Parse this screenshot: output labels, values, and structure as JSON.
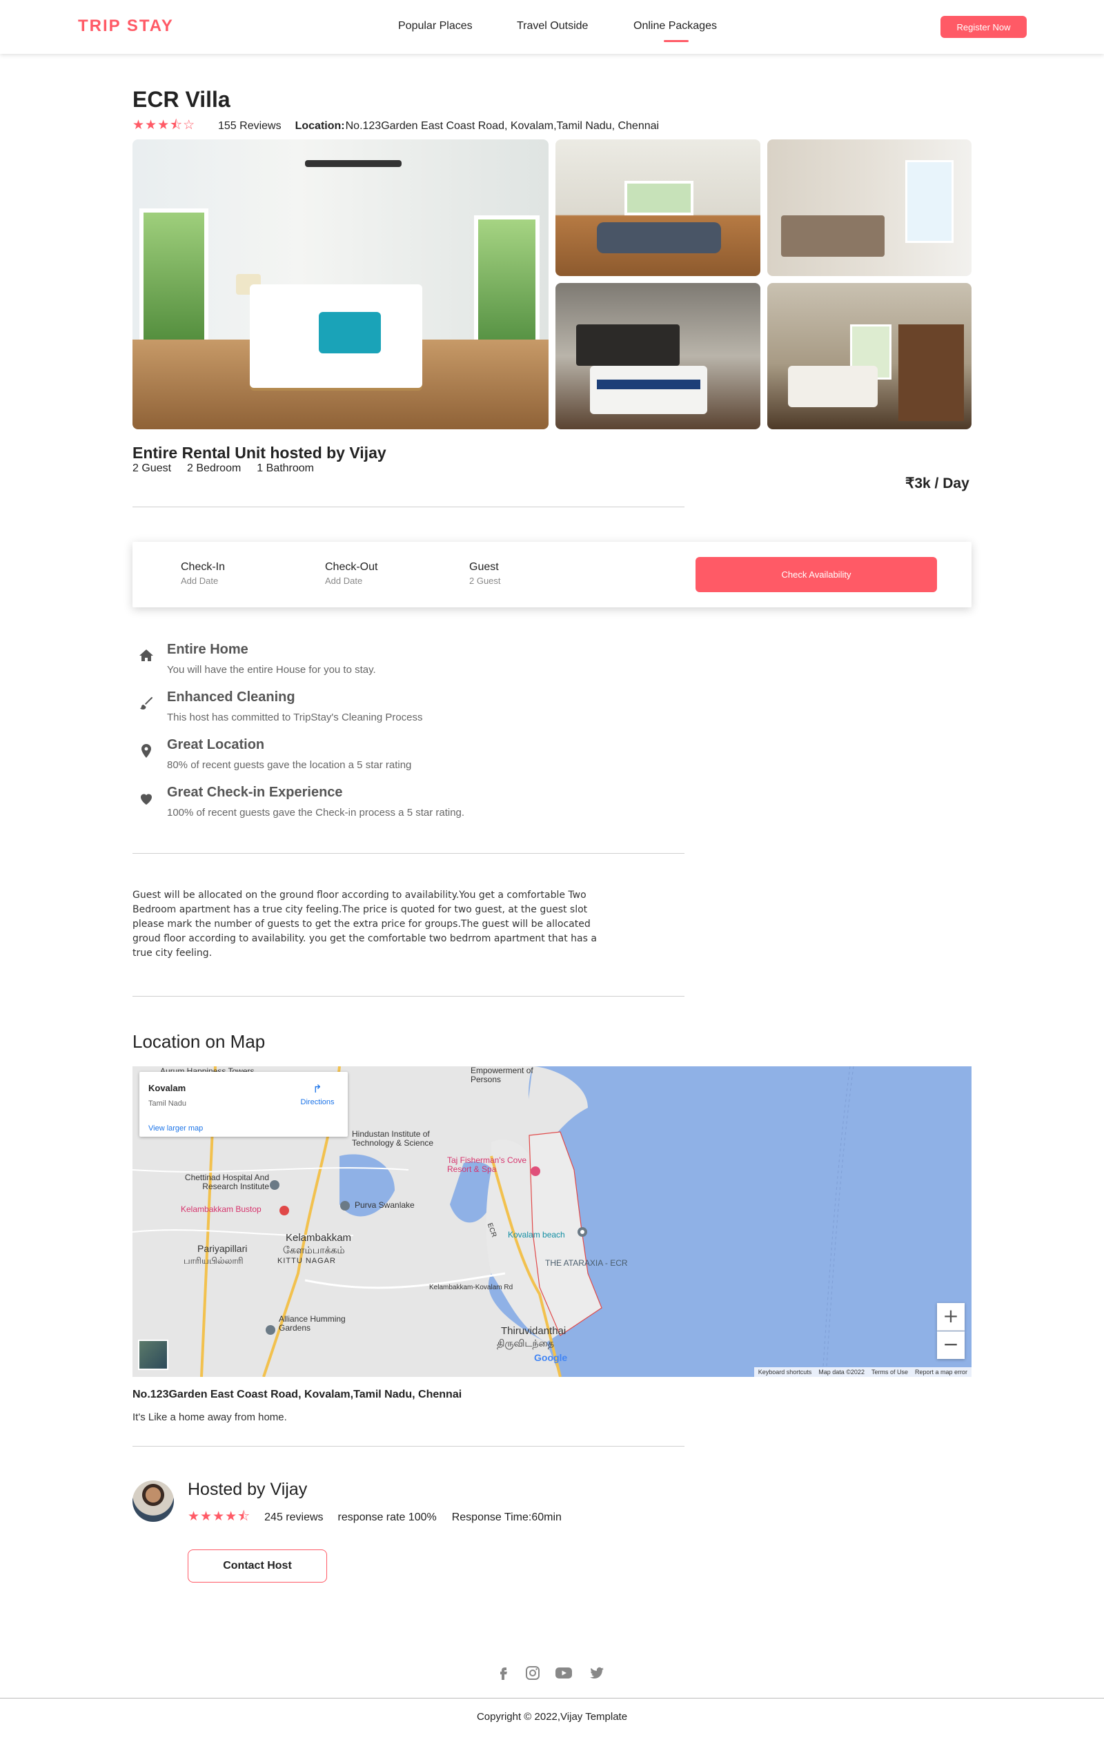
{
  "nav": {
    "logo": "TRIP STAY",
    "links": [
      "Popular Places",
      "Travel Outside",
      "Online Packages"
    ],
    "active_link": "Online Packages",
    "register_label": "Register Now",
    "accent_color": "#ff5a66"
  },
  "listing": {
    "title": "ECR Villa",
    "rating": 3.5,
    "rating_stars": "★★★⯪☆",
    "reviews": "155 Reviews",
    "location_label": "Location:",
    "location_value": "No.123Garden East Coast Road, Kovalam,Tamil Nadu, Chennai"
  },
  "rental": {
    "title": "Entire Rental Unit hosted by Vijay",
    "guests": "2 Guest",
    "bedrooms": "2 Bedroom",
    "bathrooms": "1 Bathroom",
    "price": "₹3k / Day"
  },
  "booking": {
    "checkin_label": "Check-In",
    "checkin_sub": "Add Date",
    "checkout_label": "Check-Out",
    "checkout_sub": "Add Date",
    "guest_label": "Guest",
    "guest_sub": "2 Guest",
    "button_label": "Check Availability"
  },
  "features": [
    {
      "icon": "home-icon",
      "title": "Entire Home",
      "desc": "You will have the entire House for you to stay."
    },
    {
      "icon": "brush-icon",
      "title": "Enhanced Cleaning",
      "desc": "This host has committed to TripStay's Cleaning Process"
    },
    {
      "icon": "map-pin-icon",
      "title": "Great Location",
      "desc": "80% of recent guests gave the location a 5 star rating"
    },
    {
      "icon": "heart-icon",
      "title": "Great Check-in Experience",
      "desc": "100% of recent guests gave the Check-in process a 5 star rating."
    }
  ],
  "description": "Guest will be allocated on the ground floor according to availability.You get a comfortable Two Bedroom apartment has a true city feeling.The price is quoted for two guest, at the guest slot please mark the number of guests to get the extra price for groups.The guest will be allocated groud floor according to availability. you get the comfortable two bedrrom apartment that has a true city feeling.",
  "map": {
    "heading": "Location on Map",
    "card_place": "Kovalam",
    "card_region": "Tamil Nadu",
    "card_directions": "Directions",
    "card_larger": "View larger map",
    "labels": {
      "aurum": "Aurum Happiness Towers",
      "empowerment": "Empowerment of Persons",
      "hindustan": "Hindustan Institute of Technology & Science",
      "chettinad": "Chettinad Hospital And Research Institute",
      "bustop": "Kelambakkam Bustop",
      "purva": "Purva Swanlake",
      "kelambakkam": "Kelambakkam",
      "kelambakkam_ta": "கேளம்பாக்கம்",
      "pariyapillari": "Pariyapillari",
      "pariyapillari_ta": "பாரியபில்லாரி",
      "kittu": "KITTU NAGAR",
      "taj": "Taj Fisherman's Cove Resort & Spa",
      "kovalam_beach": "Kovalam beach",
      "ataraxia": "THE ATARAXIA - ECR",
      "alliance": "Alliance Humming Gardens",
      "thiruvidanthai": "Thiruvidanthai",
      "thiruvidanthai_ta": "திருவிடந்தை",
      "ecr": "ECR",
      "kovalam_rd": "Kelambakkam-Kovalam Rd",
      "google": "Google"
    },
    "zoom_in": "+",
    "zoom_out": "−",
    "footer": [
      "Keyboard shortcuts",
      "Map data ©2022",
      "Terms of Use",
      "Report a map error"
    ]
  },
  "address": {
    "line": "No.123Garden East Coast Road, Kovalam,Tamil Nadu, Chennai",
    "tagline": "It's Like a home away from home."
  },
  "host": {
    "name": "Hosted by Vijay",
    "rating": 4.5,
    "rating_stars": "★★★★⯪",
    "reviews": "245 reviews",
    "response_rate": "response rate 100%",
    "response_time": "Response Time:60min",
    "contact_label": "Contact Host"
  },
  "footer": {
    "social_icons": [
      "facebook-icon",
      "instagram-icon",
      "youtube-icon",
      "twitter-icon"
    ],
    "copyright": "Copyright © 2022,Vijay Template"
  }
}
